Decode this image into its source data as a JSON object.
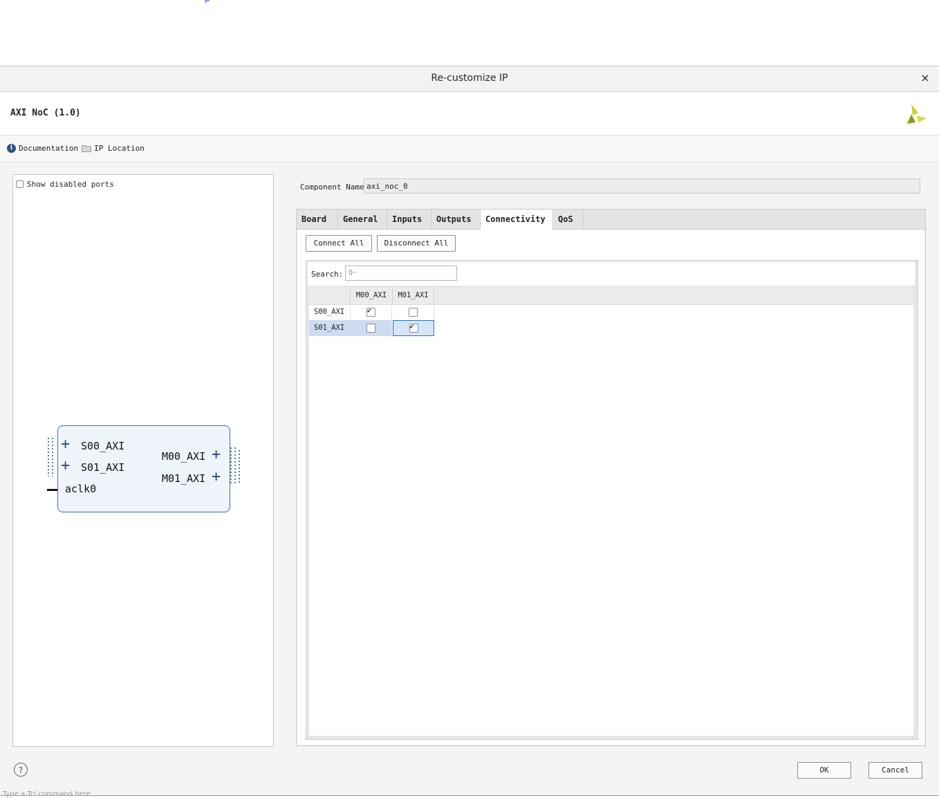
{
  "background": {
    "top_link_fragment": "p",
    "bottom_console_hint": "Type a Tcl command here"
  },
  "dialog": {
    "title": "Re-customize IP",
    "close_symbol": "×",
    "ip_name": "AXI NoC (1.0)",
    "links": {
      "documentation": "Documentation",
      "ip_location": "IP Location"
    }
  },
  "left_panel": {
    "show_disabled_ports_label": "Show disabled ports",
    "show_disabled_ports_checked": false,
    "block": {
      "ports_left": [
        "S00_AXI",
        "S01_AXI"
      ],
      "clock_port": "aclk0",
      "ports_right": [
        "M00_AXI",
        "M01_AXI"
      ],
      "outline_color": "#4a6a9a",
      "fill_color": "#eef4f9"
    }
  },
  "component": {
    "label": "Component Name",
    "value": "axi_noc_0"
  },
  "tabs": [
    "Board",
    "General",
    "Inputs",
    "Outputs",
    "Connectivity",
    "QoS"
  ],
  "active_tab": "Connectivity",
  "connectivity": {
    "connect_all": "Connect All",
    "disconnect_all": "Disconnect All",
    "search_label": "Search:",
    "search_placeholder": "Q-",
    "columns": [
      "M00_AXI",
      "M01_AXI"
    ],
    "rows": [
      {
        "name": "S00_AXI",
        "values": [
          true,
          false
        ]
      },
      {
        "name": "S01_AXI",
        "values": [
          false,
          true
        ],
        "selected": true
      }
    ]
  },
  "footer": {
    "help": "?",
    "ok": "OK",
    "cancel": "Cancel"
  },
  "colors": {
    "selection": "#cddcf2",
    "focus": "#2f6fc0",
    "logo_dark": "#8a9a1a",
    "logo_light": "#d4de3a"
  }
}
